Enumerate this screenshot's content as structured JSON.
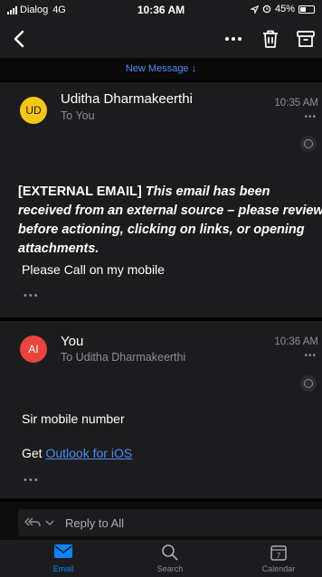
{
  "status_bar": {
    "carrier": "Dialog",
    "network": "4G",
    "time": "10:36 AM",
    "battery": "45%",
    "battery_level": 0.45
  },
  "nav": {
    "back_icon": "chevron-left-icon",
    "more_icon": "ellipsis-icon",
    "delete_icon": "trash-icon",
    "archive_icon": "archive-icon"
  },
  "new_message_banner": "New Message ↓",
  "messages": [
    {
      "avatar_initials": "UD",
      "avatar_color": "#f5c518",
      "sender": "Uditha Dharmakeerthi",
      "recipient": "To You",
      "time": "10:35 AM",
      "warning_tag": "[EXTERNAL EMAIL]",
      "warning_text": "This email has been received from an external source – please review before actioning, clicking on links, or opening attachments.",
      "body": "Please Call on my mobile"
    },
    {
      "avatar_initials": "AI",
      "avatar_color": "#e8453c",
      "sender": "You",
      "recipient": "To Uditha Dharmakeerthi",
      "time": "10:36 AM",
      "body": "Sir mobile number",
      "signature_prefix": "Get ",
      "signature_link": "Outlook for iOS"
    }
  ],
  "reply": {
    "label": "Reply to All"
  },
  "tabs": [
    {
      "label": "Email",
      "icon": "mail-icon",
      "active": true
    },
    {
      "label": "Search",
      "icon": "search-icon",
      "active": false
    },
    {
      "label": "Calendar",
      "icon": "calendar-icon",
      "active": false
    }
  ],
  "calendar_day": "7",
  "colors": {
    "accent": "#0a84ff",
    "link": "#4a8df0",
    "card_bg": "#1c1c1e",
    "page_bg": "#000000"
  }
}
